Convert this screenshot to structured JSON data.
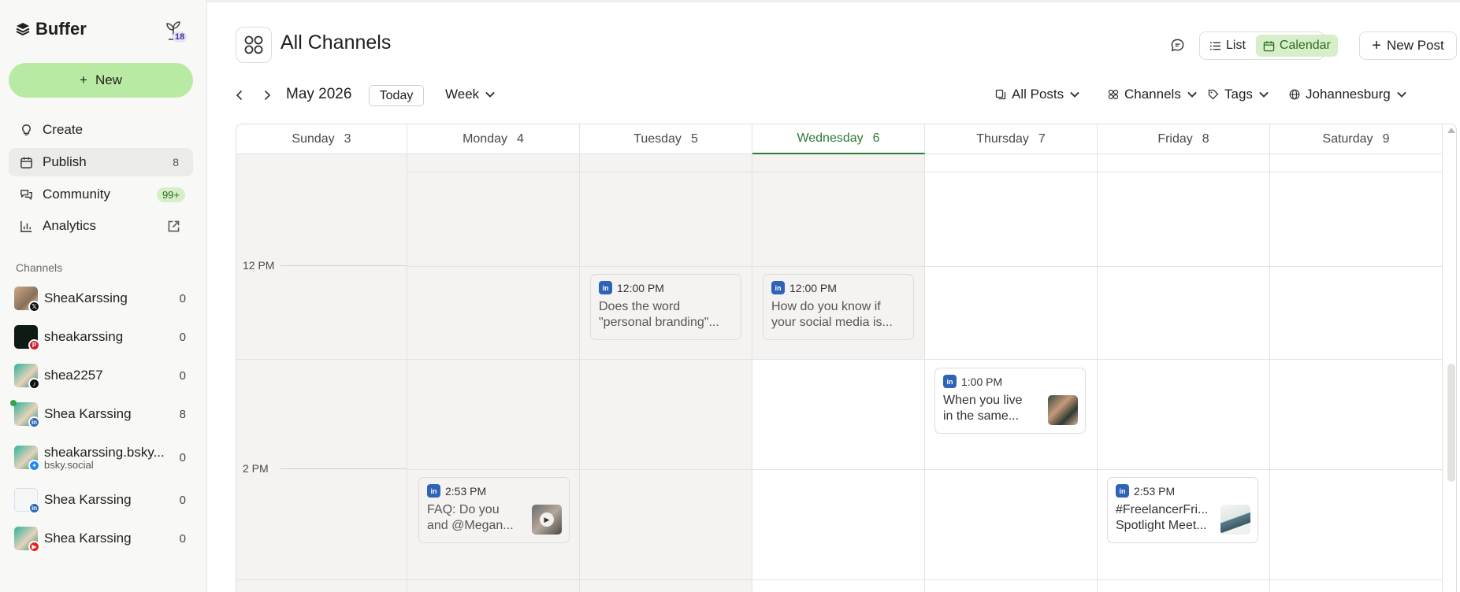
{
  "app": {
    "brand": "Buffer",
    "plant_count": "18"
  },
  "sidebar": {
    "new_label": "New",
    "nav": [
      {
        "label": "Create",
        "icon": "lightbulb-icon"
      },
      {
        "label": "Publish",
        "icon": "calendar-icon",
        "count": "8"
      },
      {
        "label": "Community",
        "icon": "chat-icon",
        "count": "99+"
      },
      {
        "label": "Analytics",
        "icon": "bar-chart-icon"
      }
    ],
    "channels_label": "Channels",
    "channels": [
      {
        "name": "SheaKarssing",
        "network": "x",
        "count": "0"
      },
      {
        "name": "sheakarssing",
        "network": "pinterest",
        "count": "0"
      },
      {
        "name": "shea2257",
        "network": "tiktok",
        "count": "0"
      },
      {
        "name": "Shea Karssing",
        "network": "linkedin",
        "count": "8"
      },
      {
        "name": "sheakarssing.bsky...",
        "sub": "bsky.social",
        "network": "bluesky",
        "count": "0"
      },
      {
        "name": "Shea Karssing",
        "network": "linkedin-page",
        "count": "0"
      },
      {
        "name": "Shea Karssing",
        "network": "youtube",
        "count": "0"
      }
    ]
  },
  "header": {
    "title": "All Channels",
    "list_label": "List",
    "calendar_label": "Calendar",
    "new_post_label": "New Post",
    "month": "May 2026",
    "today_label": "Today",
    "range": "Week",
    "filters": {
      "posts": "All Posts",
      "channels": "Channels",
      "tags": "Tags",
      "timezone": "Johannesburg"
    }
  },
  "calendar": {
    "days": [
      {
        "name": "Sunday",
        "num": "3"
      },
      {
        "name": "Monday",
        "num": "4"
      },
      {
        "name": "Tuesday",
        "num": "5"
      },
      {
        "name": "Wednesday",
        "num": "6"
      },
      {
        "name": "Thursday",
        "num": "7"
      },
      {
        "name": "Friday",
        "num": "8"
      },
      {
        "name": "Saturday",
        "num": "9"
      }
    ],
    "times": [
      "12 PM",
      "2 PM"
    ],
    "posts": [
      {
        "time": "12:00 PM",
        "line1": "Does the word",
        "line2": "\"personal branding\"..."
      },
      {
        "time": "12:00 PM",
        "line1": "How do you know if",
        "line2": "your social media is..."
      },
      {
        "time": "1:00 PM",
        "line1": "When you live",
        "line2": "in the same..."
      },
      {
        "time": "2:53 PM",
        "line1": "FAQ: Do you",
        "line2": "and @Megan..."
      },
      {
        "time": "2:53 PM",
        "line1": "#FreelancerFri...",
        "line2": "Spotlight Meet..."
      }
    ]
  },
  "colors": {
    "accent": "#2d7a35",
    "new_button": "#b9eaa3",
    "linkedin": "#2f63b8"
  }
}
